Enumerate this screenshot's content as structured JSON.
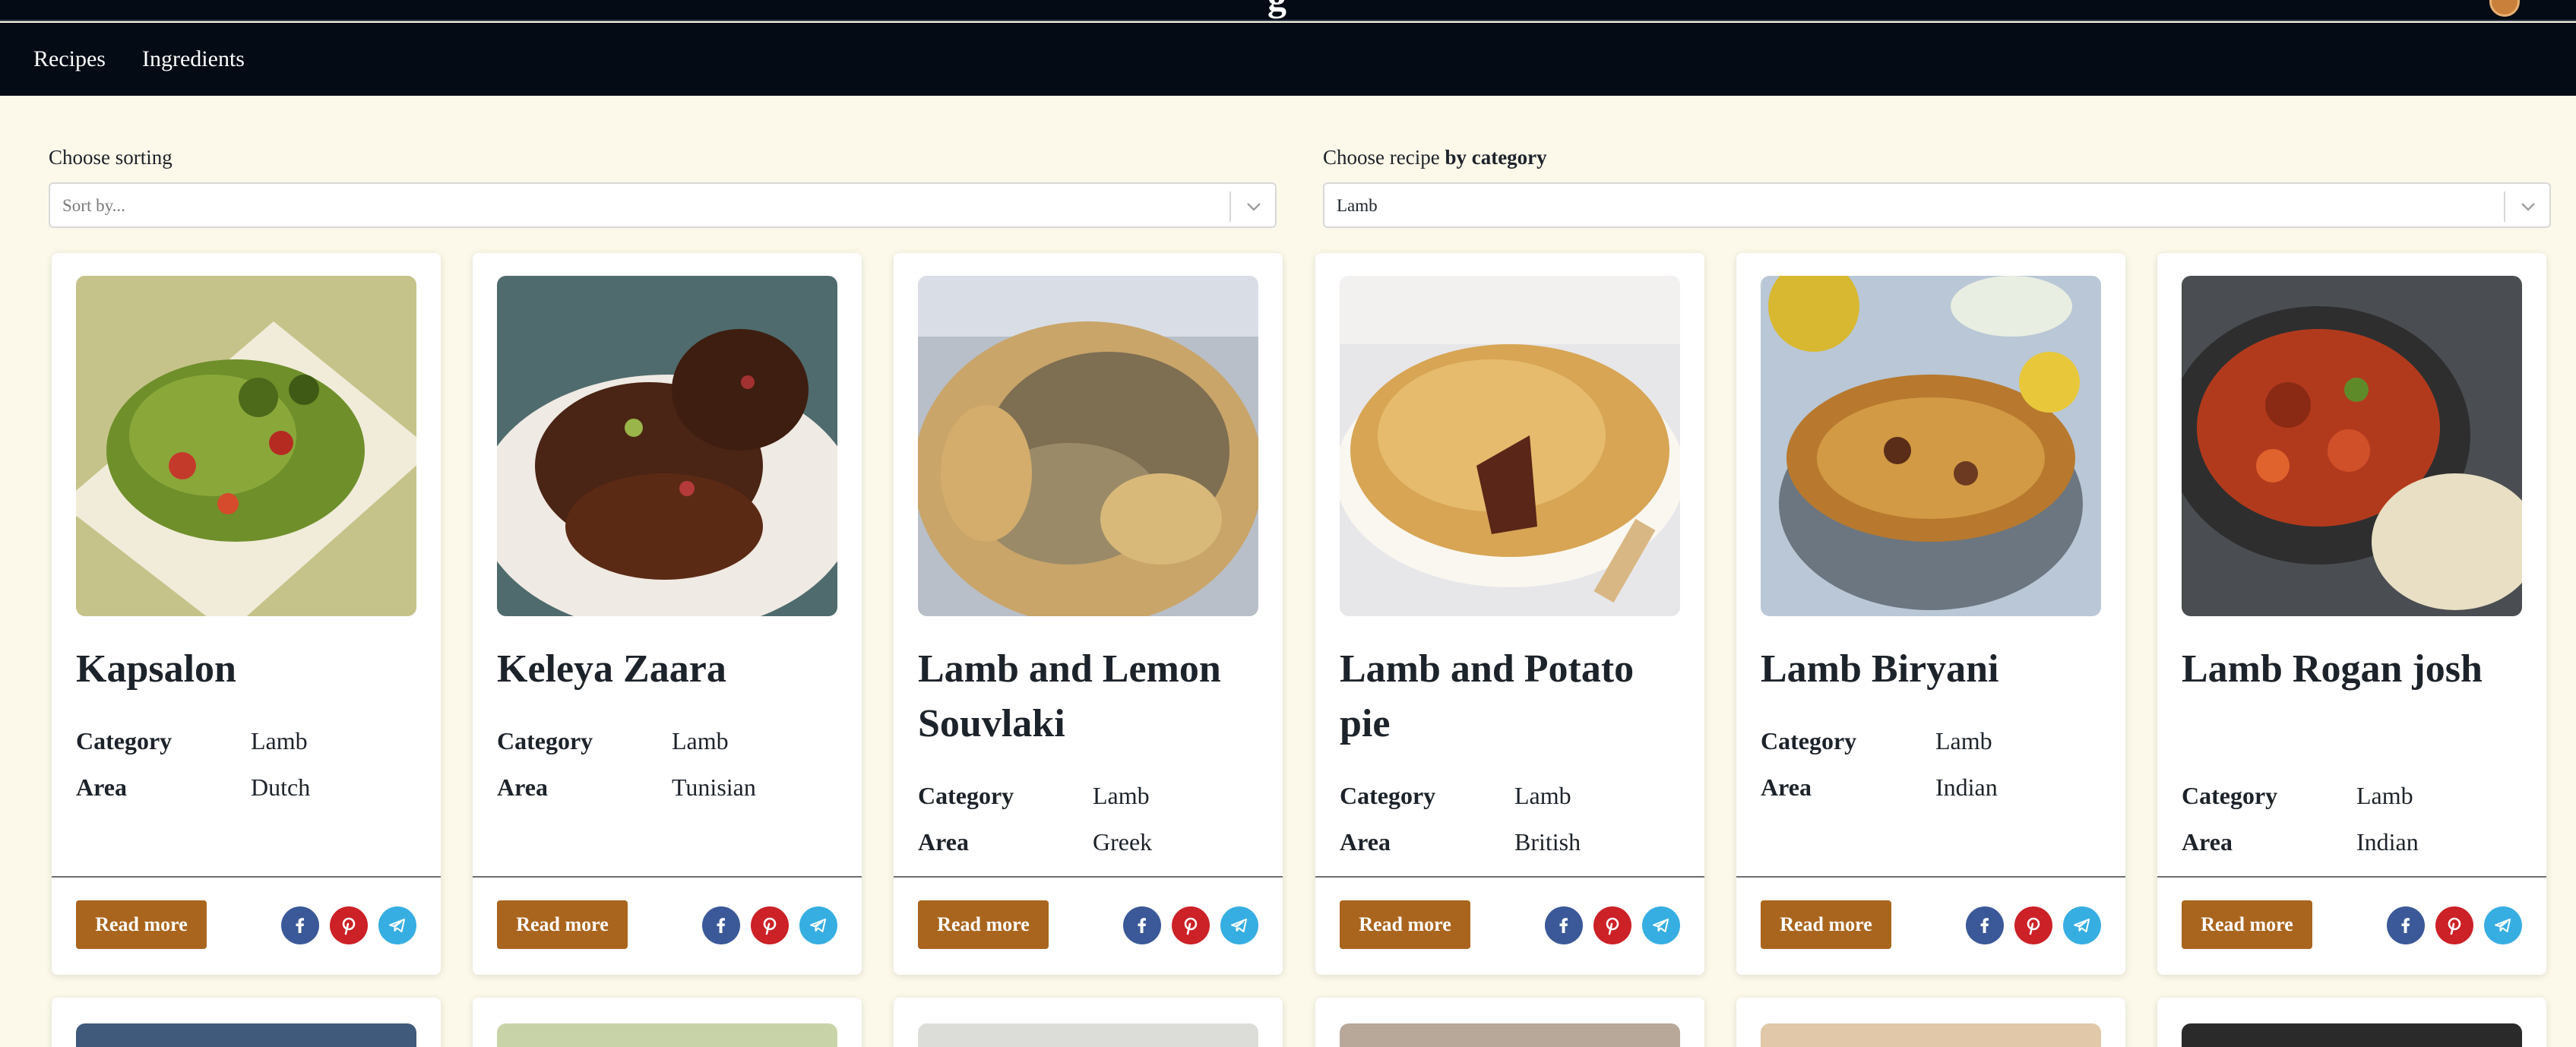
{
  "header": {
    "brand_fragment": "g"
  },
  "nav": {
    "items": [
      {
        "label": "Recipes"
      },
      {
        "label": "Ingredients"
      }
    ]
  },
  "filters": {
    "sorting": {
      "label": "Choose sorting",
      "placeholder": "Sort by..."
    },
    "category": {
      "label_prefix": "Choose recipe ",
      "label_bold": "by category",
      "value": "Lamb"
    }
  },
  "card_fields": {
    "category_label": "Category",
    "area_label": "Area",
    "read_more_label": "Read more"
  },
  "recipes": [
    {
      "name": "Kapsalon",
      "category": "Lamb",
      "area": "Dutch"
    },
    {
      "name": "Keleya Zaara",
      "category": "Lamb",
      "area": "Tunisian"
    },
    {
      "name": "Lamb and Lemon Souvlaki",
      "category": "Lamb",
      "area": "Greek"
    },
    {
      "name": "Lamb and Potato pie",
      "category": "Lamb",
      "area": "British"
    },
    {
      "name": "Lamb Biryani",
      "category": "Lamb",
      "area": "Indian"
    },
    {
      "name": "Lamb Rogan josh",
      "category": "Lamb",
      "area": "Indian"
    }
  ],
  "colors": {
    "page_bg": "#fdf9ea",
    "navbar_bg": "#040b14",
    "button_bg": "#a9651e",
    "facebook": "#3b5998",
    "pinterest": "#cb2127",
    "telegram": "#37aee2"
  },
  "icons": [
    "facebook-icon",
    "pinterest-icon",
    "telegram-icon",
    "chevron-down-icon"
  ]
}
